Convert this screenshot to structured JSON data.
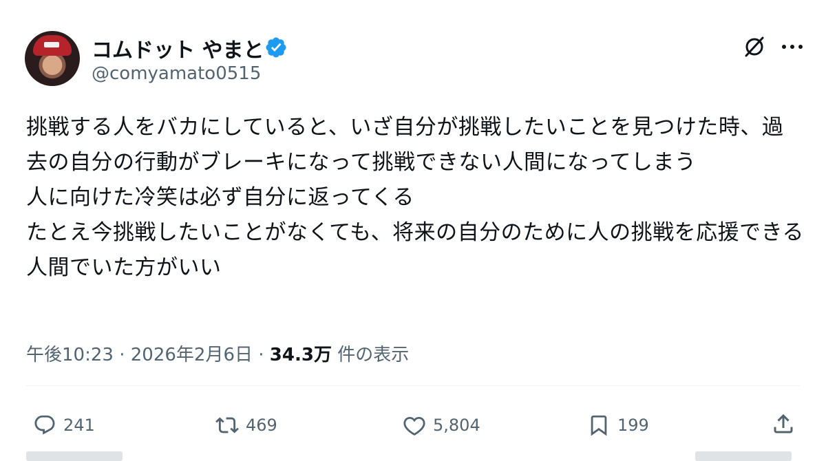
{
  "author": {
    "display_name": "コムドット やまと",
    "handle": "@comyamato0515",
    "verified_color": "#1d9bf0"
  },
  "icons": {
    "avatar": "profile-photo",
    "verified": "verified-badge-icon",
    "grok": "grok-icon",
    "more": "more-horizontal-icon",
    "reply": "reply-bubble-icon",
    "retweet": "retweet-icon",
    "like": "heart-icon",
    "bookmark": "bookmark-icon",
    "share": "share-icon"
  },
  "post": {
    "text": "挑戦する人をバカにしていると、いざ自分が挑戦したいことを見つけた時、過去の自分の行動がブレーキになって挑戦できない人間になってしまう\n人に向けた冷笑は必ず自分に返ってくる\nたとえ今挑戦したいことがなくても、将来の自分のために人の挑戦を応援できる人間でいた方がいい"
  },
  "meta": {
    "time": "午後10:23",
    "separator": "·",
    "date": "2026年2月6日",
    "views_count": "34.3万",
    "views_label": "件の表示"
  },
  "actions": {
    "replies": "241",
    "retweets": "469",
    "likes": "5,804",
    "bookmarks": "199"
  }
}
